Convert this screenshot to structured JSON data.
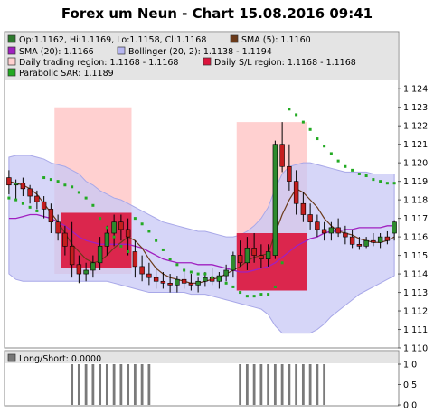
{
  "chart_data": {
    "type": "candlestick",
    "title": "Forex um Neun - Chart 15.08.2016 09:41",
    "legend": {
      "placement": "top-left",
      "entries": [
        {
          "label": "Op:1.1162, Hi:1.1169, Lo:1.1158, Cl:1.1168",
          "color": "#2d7a2d"
        },
        {
          "label": "SMA (5): 1.1160",
          "color": "#6b3a1a"
        },
        {
          "label": "SMA (20): 1.1166",
          "color": "#a020c0"
        },
        {
          "label": "Bollinger (20, 2): 1.1138 - 1.1194",
          "color": "#b7b7f2"
        },
        {
          "label": "Daily trading region: 1.1168 - 1.1168",
          "color": "#ffd0d0"
        },
        {
          "label": "Daily S/L region: 1.1168 - 1.1168",
          "color": "#dc143c"
        },
        {
          "label": "Parabolic SAR: 1.1189",
          "color": "#22aa22"
        }
      ]
    },
    "y_axis": {
      "ylim": [
        1.11,
        1.1245
      ],
      "ticks": [
        "1.110",
        "1.111",
        "1.112",
        "1.113",
        "1.114",
        "1.115",
        "1.116",
        "1.117",
        "1.118",
        "1.119",
        "1.120",
        "1.121",
        "1.122",
        "1.123",
        "1.124"
      ],
      "position": "right",
      "grid": false
    },
    "candles": [
      [
        1.1192,
        1.1196,
        1.1183,
        1.1188
      ],
      [
        1.1188,
        1.1191,
        1.118,
        1.1189
      ],
      [
        1.1189,
        1.1192,
        1.1182,
        1.1186
      ],
      [
        1.1186,
        1.1188,
        1.1178,
        1.1182
      ],
      [
        1.1182,
        1.1185,
        1.1175,
        1.1179
      ],
      [
        1.1179,
        1.1182,
        1.117,
        1.1175
      ],
      [
        1.1175,
        1.1178,
        1.1162,
        1.1168
      ],
      [
        1.1168,
        1.1172,
        1.1158,
        1.1162
      ],
      [
        1.1162,
        1.1166,
        1.115,
        1.1155
      ],
      [
        1.1155,
        1.1168,
        1.1138,
        1.1145
      ],
      [
        1.1145,
        1.115,
        1.1135,
        1.114
      ],
      [
        1.114,
        1.1146,
        1.1136,
        1.1142
      ],
      [
        1.1142,
        1.115,
        1.1138,
        1.1146
      ],
      [
        1.1146,
        1.116,
        1.1142,
        1.1155
      ],
      [
        1.1155,
        1.1166,
        1.115,
        1.1162
      ],
      [
        1.1162,
        1.1172,
        1.1155,
        1.1168
      ],
      [
        1.1168,
        1.1172,
        1.1158,
        1.1164
      ],
      [
        1.1164,
        1.117,
        1.115,
        1.116
      ],
      [
        1.1152,
        1.1158,
        1.1138,
        1.1144
      ],
      [
        1.1144,
        1.115,
        1.1136,
        1.114
      ],
      [
        1.114,
        1.1146,
        1.1134,
        1.1138
      ],
      [
        1.1138,
        1.1144,
        1.1132,
        1.1136
      ],
      [
        1.1136,
        1.1141,
        1.1132,
        1.1135
      ],
      [
        1.1135,
        1.114,
        1.113,
        1.1134
      ],
      [
        1.1134,
        1.1139,
        1.113,
        1.1137
      ],
      [
        1.1137,
        1.1142,
        1.1132,
        1.1135
      ],
      [
        1.1135,
        1.114,
        1.1131,
        1.1134
      ],
      [
        1.1134,
        1.1138,
        1.113,
        1.1136
      ],
      [
        1.1136,
        1.1141,
        1.1133,
        1.1138
      ],
      [
        1.1138,
        1.1143,
        1.1134,
        1.1136
      ],
      [
        1.1136,
        1.1141,
        1.1132,
        1.1139
      ],
      [
        1.1139,
        1.1145,
        1.1136,
        1.1142
      ],
      [
        1.1142,
        1.1152,
        1.1138,
        1.115
      ],
      [
        1.115,
        1.1158,
        1.1144,
        1.1146
      ],
      [
        1.1146,
        1.116,
        1.1142,
        1.1154
      ],
      [
        1.1154,
        1.1162,
        1.1146,
        1.115
      ],
      [
        1.115,
        1.1156,
        1.1143,
        1.1148
      ],
      [
        1.1148,
        1.1156,
        1.1144,
        1.1152
      ],
      [
        1.115,
        1.1212,
        1.1148,
        1.121
      ],
      [
        1.121,
        1.1222,
        1.1195,
        1.1198
      ],
      [
        1.1198,
        1.121,
        1.1185,
        1.119
      ],
      [
        1.119,
        1.1196,
        1.1172,
        1.1178
      ],
      [
        1.1178,
        1.1184,
        1.1168,
        1.1172
      ],
      [
        1.1172,
        1.1178,
        1.1164,
        1.1168
      ],
      [
        1.1168,
        1.1172,
        1.116,
        1.1164
      ],
      [
        1.1164,
        1.1168,
        1.1158,
        1.1162
      ],
      [
        1.1162,
        1.1168,
        1.1158,
        1.1165
      ],
      [
        1.1165,
        1.117,
        1.116,
        1.1162
      ],
      [
        1.1162,
        1.1166,
        1.1156,
        1.116
      ],
      [
        1.116,
        1.1164,
        1.1154,
        1.1156
      ],
      [
        1.1156,
        1.116,
        1.1153,
        1.1155
      ],
      [
        1.1155,
        1.116,
        1.1154,
        1.1158
      ],
      [
        1.1158,
        1.1162,
        1.1155,
        1.1157
      ],
      [
        1.1157,
        1.1162,
        1.1154,
        1.116
      ],
      [
        1.116,
        1.1163,
        1.1156,
        1.1158
      ],
      [
        1.1162,
        1.1169,
        1.1158,
        1.1168
      ]
    ],
    "sma5": [
      1.119,
      1.1189,
      1.1188,
      1.1186,
      1.1183,
      1.1178,
      1.1173,
      1.1168,
      1.1162,
      1.1156,
      1.1152,
      1.1148,
      1.1146,
      1.1147,
      1.115,
      1.1154,
      1.1157,
      1.116,
      1.1158,
      1.1154,
      1.1148,
      1.1143,
      1.114,
      1.1138,
      1.1137,
      1.1136,
      1.1135,
      1.1135,
      1.1136,
      1.1137,
      1.1138,
      1.114,
      1.1142,
      1.1144,
      1.1147,
      1.1149,
      1.115,
      1.1151,
      1.1162,
      1.1172,
      1.118,
      1.1186,
      1.1184,
      1.118,
      1.1176,
      1.117,
      1.1166,
      1.1163,
      1.1162,
      1.1161,
      1.1159,
      1.1158,
      1.1157,
      1.1157,
      1.1158,
      1.116
    ],
    "sma20": [
      1.117,
      1.117,
      1.1171,
      1.1172,
      1.1172,
      1.1171,
      1.117,
      1.1168,
      1.1166,
      1.1163,
      1.116,
      1.1158,
      1.1157,
      1.1156,
      1.1156,
      1.1156,
      1.1156,
      1.1156,
      1.1155,
      1.1154,
      1.1152,
      1.115,
      1.1148,
      1.1147,
      1.1146,
      1.1146,
      1.1146,
      1.1145,
      1.1145,
      1.1145,
      1.1144,
      1.1143,
      1.1142,
      1.1141,
      1.1141,
      1.1142,
      1.1143,
      1.1144,
      1.1146,
      1.1149,
      1.1152,
      1.1155,
      1.1157,
      1.1159,
      1.116,
      1.1162,
      1.1163,
      1.1163,
      1.1164,
      1.1164,
      1.1165,
      1.1165,
      1.1165,
      1.1165,
      1.1166,
      1.1166
    ],
    "bollinger_upper": [
      1.1203,
      1.1204,
      1.1204,
      1.1204,
      1.1203,
      1.1202,
      1.12,
      1.1199,
      1.1198,
      1.1196,
      1.1194,
      1.119,
      1.1188,
      1.1185,
      1.1183,
      1.1181,
      1.118,
      1.1178,
      1.1176,
      1.1174,
      1.1172,
      1.117,
      1.1168,
      1.1167,
      1.1166,
      1.1165,
      1.1164,
      1.1163,
      1.1163,
      1.1162,
      1.1161,
      1.116,
      1.116,
      1.1161,
      1.1163,
      1.1166,
      1.117,
      1.1176,
      1.1186,
      1.1194,
      1.1198,
      1.1199,
      1.12,
      1.12,
      1.1199,
      1.1198,
      1.1197,
      1.1196,
      1.1195,
      1.1195,
      1.1195,
      1.1195,
      1.1194,
      1.1194,
      1.1194,
      1.1194
    ],
    "bollinger_lower": [
      1.114,
      1.1137,
      1.1136,
      1.1136,
      1.1136,
      1.1136,
      1.1136,
      1.1136,
      1.1136,
      1.1136,
      1.1136,
      1.1136,
      1.1136,
      1.1136,
      1.1136,
      1.1135,
      1.1134,
      1.1133,
      1.1132,
      1.1131,
      1.113,
      1.113,
      1.113,
      1.113,
      1.113,
      1.113,
      1.1129,
      1.1129,
      1.1129,
      1.1128,
      1.1127,
      1.1126,
      1.1125,
      1.1124,
      1.1123,
      1.1122,
      1.1121,
      1.1118,
      1.1112,
      1.1108,
      1.1108,
      1.1108,
      1.1108,
      1.1108,
      1.111,
      1.1113,
      1.1117,
      1.112,
      1.1123,
      1.1126,
      1.1129,
      1.1131,
      1.1133,
      1.1135,
      1.1137,
      1.1139
    ],
    "parabolic_sar": [
      1.1181,
      1.118,
      1.1178,
      1.1176,
      1.1174,
      1.1192,
      1.1191,
      1.119,
      1.1188,
      1.1187,
      1.1184,
      1.1181,
      1.1177,
      1.117,
      1.1165,
      1.116,
      1.1155,
      1.1152,
      1.117,
      1.1167,
      1.1163,
      1.1158,
      1.1153,
      1.1148,
      1.1145,
      1.1142,
      1.1141,
      1.114,
      1.114,
      1.1138,
      1.1137,
      1.1135,
      1.1133,
      1.113,
      1.1128,
      1.1128,
      1.1129,
      1.1129,
      1.1133,
      1.1146,
      1.1229,
      1.1226,
      1.1222,
      1.1218,
      1.1213,
      1.1209,
      1.1205,
      1.1201,
      1.1198,
      1.1196,
      1.1194,
      1.1193,
      1.1191,
      1.119,
      1.1189,
      1.1189
    ],
    "trading_regions": [
      {
        "from": 7,
        "to": 17,
        "low": 1.114,
        "high": 1.123
      },
      {
        "from": 33,
        "to": 42,
        "low": 1.1131,
        "high": 1.1222
      }
    ],
    "sl_regions": [
      {
        "from": 8,
        "to": 17,
        "low": 1.1143,
        "high": 1.1173
      },
      {
        "from": 33,
        "to": 42,
        "low": 1.1131,
        "high": 1.1162
      }
    ],
    "sub_panel": {
      "legend_label": "Long/Short: 0.0000",
      "legend_color": "#777777",
      "ylim": [
        0,
        1
      ],
      "ticks": [
        "0.0",
        "0.5",
        "1.0"
      ],
      "bars": [
        {
          "from": 9,
          "to": 20,
          "value": 1
        },
        {
          "from": 33,
          "to": 45,
          "value": 1
        }
      ]
    }
  }
}
